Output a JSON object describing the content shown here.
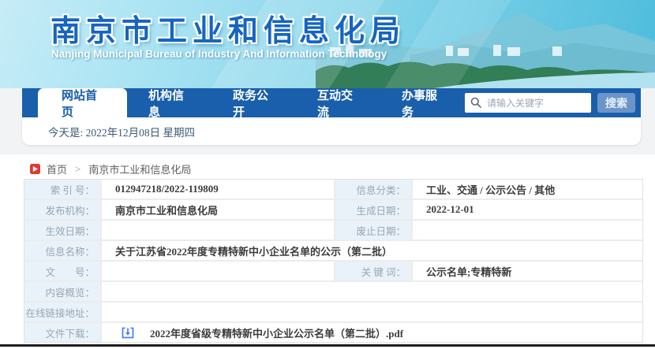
{
  "banner": {
    "title_cn": "南京市工业和信息化局",
    "title_en": "Nanjing Municipal Bureau of Industry And Information Technology"
  },
  "nav": {
    "tabs": [
      {
        "label": "网站首页",
        "active": true
      },
      {
        "label": "机构信息",
        "active": false
      },
      {
        "label": "政务公开",
        "active": false
      },
      {
        "label": "互动交流",
        "active": false
      },
      {
        "label": "办事服务",
        "active": false
      }
    ],
    "search_placeholder": "请输入关键字",
    "search_button": "搜索"
  },
  "date_bar": {
    "text": "今天是: 2022年12月08日  星期四"
  },
  "breadcrumb": {
    "home": "首页",
    "separator": ">",
    "current": "南京市工业和信息化局"
  },
  "info_table": {
    "rows": [
      {
        "label1": "索 引 号：",
        "value1": "012947218/2022-119809",
        "label2": "信息分类：",
        "value2": "工业、交通 / 公示公告 / 其他"
      },
      {
        "label1": "发布机构：",
        "value1": "南京市工业和信息化局",
        "label2": "生成日期：",
        "value2": "2022-12-01"
      },
      {
        "label1": "生效日期：",
        "value1": "",
        "label2": "废止日期：",
        "value2": ""
      },
      {
        "label1": "信息名称：",
        "value1": "关于江苏省2022年度专精特新中小企业名单的公示（第二批）"
      },
      {
        "label1": "文　　号：",
        "value1": "",
        "label2": "关 键 词：",
        "value2": "公示名单;专精特新"
      },
      {
        "label1": "内容概览：",
        "value1": ""
      },
      {
        "label1": "在线链接地址：",
        "value1": ""
      },
      {
        "label1": "文件下载：",
        "file_name": "2022年度省级专精特新中小企业公示名单（第二批）.pdf"
      }
    ]
  },
  "colors": {
    "nav_blue": "#1a5fab",
    "search_button_blue": "#6b95c9",
    "label_cell_bg": "#e9f2f9",
    "download_icon_blue": "#4a86e8",
    "breadcrumb_red": "#e0392e",
    "title_blue": "#1565c0"
  }
}
